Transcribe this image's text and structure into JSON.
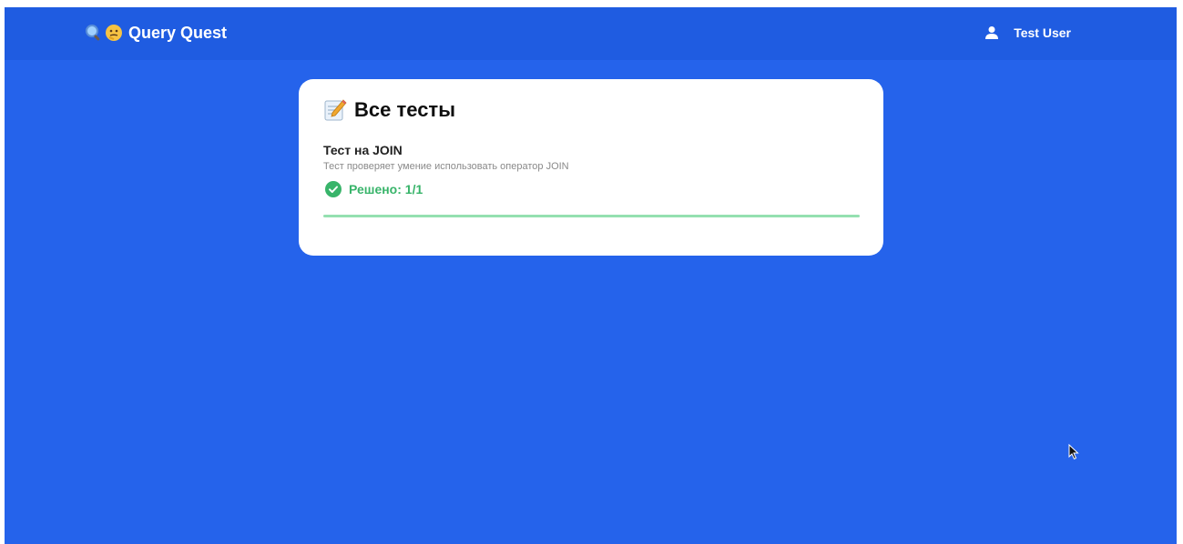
{
  "header": {
    "brand_emojis": [
      "magnifier-icon",
      "thinking-face-icon"
    ],
    "brand_label": "Query Quest",
    "user_icon": "user-icon",
    "user_name": "Test User"
  },
  "main": {
    "title_icon": "memo-icon",
    "title": "Все тесты",
    "tests": [
      {
        "name": "Тест на JOIN",
        "description": "Тест проверяет умение использовать оператор JOIN",
        "status_icon": "check-circle-icon",
        "status": "Решено: 1/1",
        "progress_fraction": 1.0
      }
    ]
  },
  "colors": {
    "background": "#2563eb",
    "header": "#1f5ce1",
    "card": "#ffffff",
    "success": "#38b46a",
    "progress": "#94e0b0"
  }
}
